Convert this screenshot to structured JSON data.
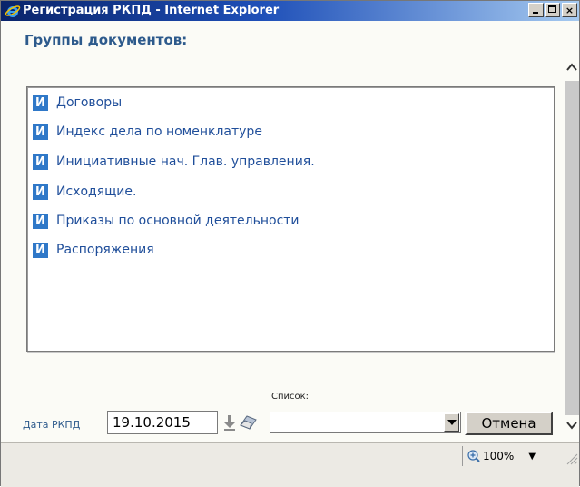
{
  "window": {
    "title": "Регистрация РКПД - Internet Explorer",
    "caption_min": "_",
    "caption_close": "×"
  },
  "main": {
    "group_title": "Группы документов:",
    "badge_letter": "И",
    "items": [
      {
        "label": "Договоры"
      },
      {
        "label": "Индекс дела по номенклатуре"
      },
      {
        "label": "Инициативные нач. Глав. управления."
      },
      {
        "label": "Исходящие."
      },
      {
        "label": "Приказы по основной деятельности"
      },
      {
        "label": "Распоряжения"
      }
    ]
  },
  "form": {
    "date_label": "Дата РКПД",
    "date_value": "19.10.2015",
    "list_label": "Список:",
    "list_value": "",
    "cancel_label": "Отмена"
  },
  "statusbar": {
    "zoom": "100%",
    "zoom_arrow": "▼"
  },
  "colors": {
    "titlebar_start": "#0a246a",
    "titlebar_end": "#a6caf0",
    "accent_text": "#1f4e9a",
    "badge": "#2f78c8",
    "heading": "#2d5a8c"
  }
}
